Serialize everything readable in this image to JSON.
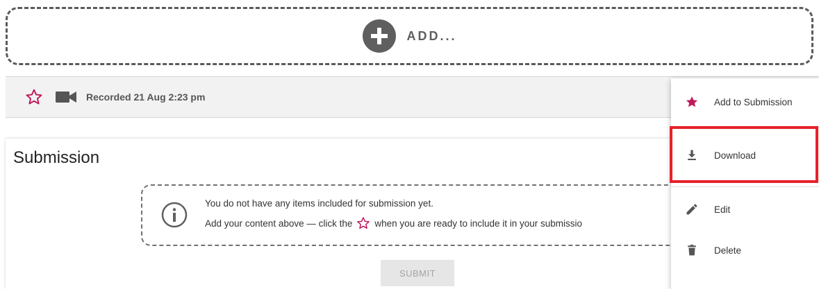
{
  "add_zone": {
    "label": "ADD...",
    "icon": "plus-circle-icon"
  },
  "recording": {
    "label": "Recorded 21 Aug 2:23 pm",
    "star_icon": "star-outline-icon",
    "media_icon": "video-camera-icon"
  },
  "submission": {
    "title": "Submission",
    "notice_line1": "You do not have any items included for submission yet.",
    "notice_line2_before": "Add your content above — click the",
    "notice_line2_after": "when you are ready to include it in your submissio",
    "info_icon": "info-circle-icon",
    "submit_label": "SUBMIT"
  },
  "context_menu": {
    "items": [
      {
        "label": "Add to Submission",
        "icon": "star-filled-icon"
      },
      {
        "label": "Download",
        "icon": "download-icon"
      },
      {
        "label": "Edit",
        "icon": "pencil-icon"
      },
      {
        "label": "Delete",
        "icon": "trash-icon"
      }
    ]
  },
  "colors": {
    "accent_star": "#c2185b",
    "highlight": "#e8202a",
    "icon_gray": "#5f5f5f"
  }
}
